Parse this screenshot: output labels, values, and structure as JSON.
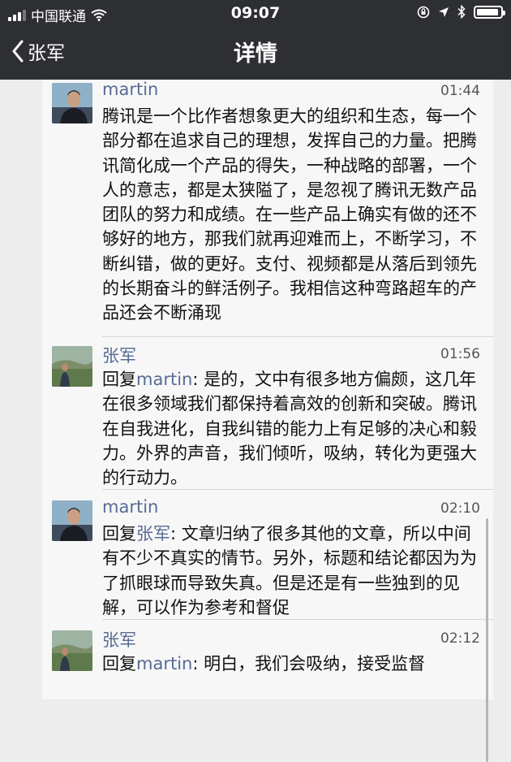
{
  "status_bar": {
    "carrier": "中国联通",
    "time": "09:07"
  },
  "nav": {
    "back_label": "张军",
    "title": "详情"
  },
  "comments": [
    {
      "name": "martin",
      "time": "01:44",
      "text": "腾讯是一个比作者想象更大的组织和生态，每一个部分都在追求自己的理想，发挥自己的力量。把腾讯简化成一个产品的得失，一种战略的部署，一个人的意志，都是太狭隘了，是忽视了腾讯无数产品团队的努力和成绩。在一些产品上确实有做的还不够好的地方，那我们就再迎难而上，不断学习，不断纠错，做的更好。支付、视频都是从落后到领先的长期奋斗的鲜活例子。我相信这种弯路超车的产品还会不断涌现"
    },
    {
      "name": "张军",
      "time": "01:56",
      "reply_prefix": "回复",
      "reply_to": "martin",
      "text": ": 是的，文中有很多地方偏颇，这几年在很多领域我们都保持着高效的创新和突破。腾讯在自我进化，自我纠错的能力上有足够的决心和毅力。外界的声音，我们倾听，吸纳，转化为更强大的行动力。"
    },
    {
      "name": "martin",
      "time": "02:10",
      "reply_prefix": "回复",
      "reply_to": "张军",
      "text": ": 文章归纳了很多其他的文章，所以中间有不少不真实的情节。另外，标题和结论都因为为了抓眼球而导致失真。但是还是有一些独到的见解，可以作为参考和督促"
    },
    {
      "name": "张军",
      "time": "02:12",
      "reply_prefix": "回复",
      "reply_to": "martin",
      "text": ": 明白，我们会吸纳，接受监督"
    }
  ],
  "icons": {
    "signal": "signal-icon",
    "wifi": "wifi-icon",
    "rotation_lock": "rotation-lock-icon",
    "location": "location-icon",
    "bluetooth": "bluetooth-icon",
    "battery": "battery-icon",
    "back": "chevron-left-icon"
  },
  "colors": {
    "nav_background": "#2e2f33",
    "name_link": "#576b95",
    "page_background": "#ededed"
  }
}
